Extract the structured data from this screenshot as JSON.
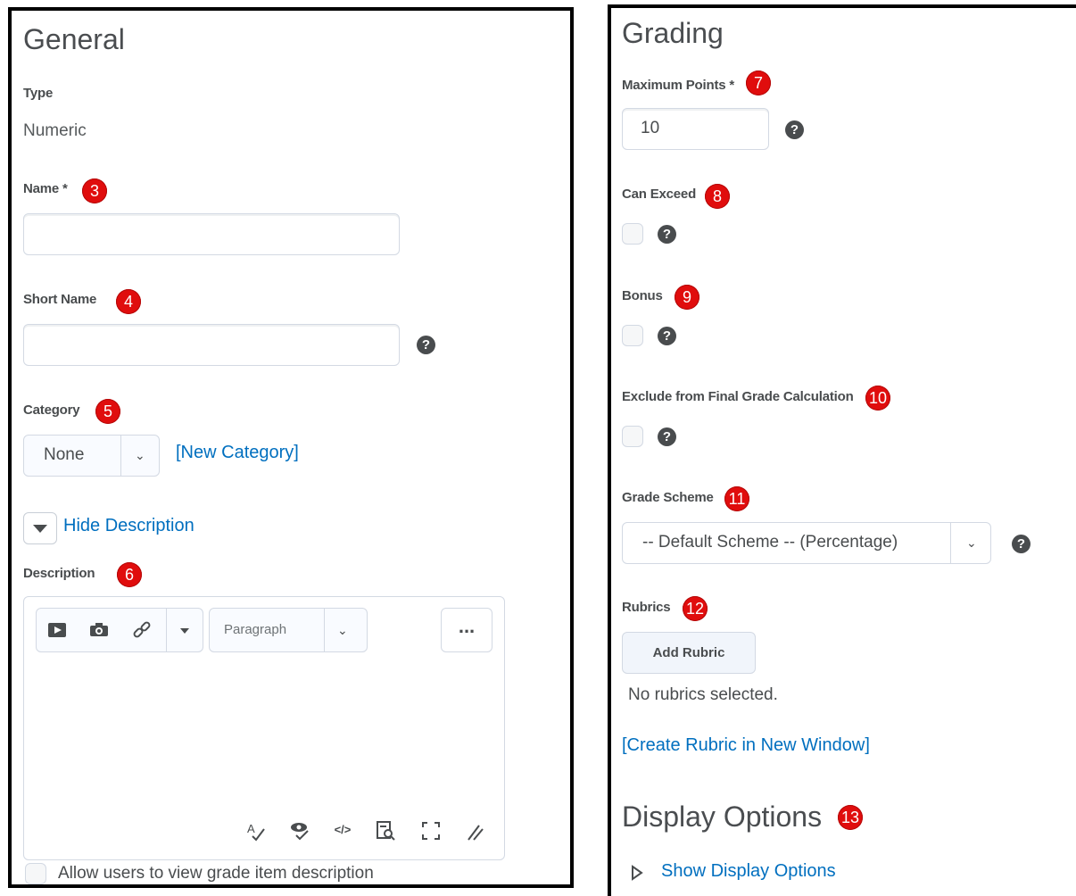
{
  "general": {
    "title": "General",
    "type_label": "Type",
    "type_value": "Numeric",
    "name_label": "Name *",
    "name_value": "",
    "short_name_label": "Short Name",
    "short_name_value": "",
    "category_label": "Category",
    "category_selected": "None",
    "new_category_link": "[New Category]",
    "hide_description_link": "Hide Description",
    "description_label": "Description",
    "editor": {
      "format_selected": "Paragraph",
      "more_label": "...",
      "toolbar_icons": [
        "video-icon",
        "camera-icon",
        "link-icon",
        "dropdown-icon",
        "spellcheck-icon",
        "accessibility-check-icon",
        "source-code-icon",
        "preview-icon",
        "fullscreen-icon",
        "resize-icon"
      ]
    },
    "allow_view_label": "Allow users to view grade item description"
  },
  "grading": {
    "title": "Grading",
    "max_points_label": "Maximum Points *",
    "max_points_value": "10",
    "can_exceed_label": "Can Exceed",
    "bonus_label": "Bonus",
    "exclude_label": "Exclude from Final Grade Calculation",
    "grade_scheme_label": "Grade Scheme",
    "grade_scheme_selected": "-- Default Scheme -- (Percentage)",
    "rubrics_label": "Rubrics",
    "add_rubric_button": "Add Rubric",
    "no_rubrics_text": "No rubrics selected.",
    "create_rubric_link": "[Create Rubric in New Window]"
  },
  "display_options": {
    "title": "Display Options",
    "show_link": "Show Display Options"
  },
  "badges": [
    "3",
    "4",
    "5",
    "6",
    "7",
    "8",
    "9",
    "10",
    "11",
    "12",
    "13"
  ],
  "colors": {
    "badge": "#e00d0d",
    "link": "#006fbf",
    "text": "#494c4e",
    "border": "#d3d9e3"
  }
}
